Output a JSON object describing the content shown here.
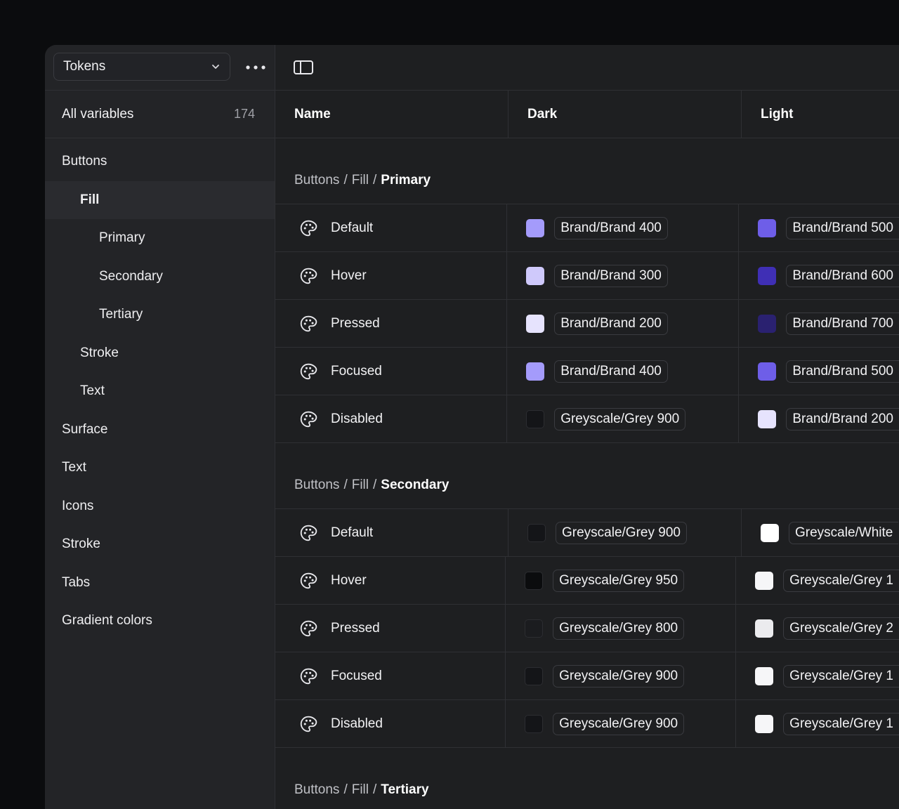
{
  "sidebar": {
    "collection": "Tokens",
    "all_variables": {
      "label": "All variables",
      "count": "174"
    },
    "groups": [
      {
        "label": "Buttons",
        "level": 0
      },
      {
        "label": "Fill",
        "level": 1,
        "active": true
      },
      {
        "label": "Primary",
        "level": 2
      },
      {
        "label": "Secondary",
        "level": 2
      },
      {
        "label": "Tertiary",
        "level": 2
      },
      {
        "label": "Stroke",
        "level": 1
      },
      {
        "label": "Text",
        "level": 1
      },
      {
        "label": "Surface",
        "level": 0
      },
      {
        "label": "Text",
        "level": 0
      },
      {
        "label": "Icons",
        "level": 0
      },
      {
        "label": "Stroke",
        "level": 0
      },
      {
        "label": "Tabs",
        "level": 0
      },
      {
        "label": "Gradient colors",
        "level": 0
      }
    ]
  },
  "table": {
    "columns": {
      "name": "Name",
      "dark": "Dark",
      "light": "Light"
    },
    "sections": [
      {
        "path": [
          "Buttons",
          "Fill",
          "Primary"
        ],
        "rows": [
          {
            "name": "Default",
            "dark": {
              "token": "Brand/Brand 400",
              "color": "#a49bfb"
            },
            "light": {
              "token": "Brand/Brand 500",
              "color": "#6e5ee8"
            }
          },
          {
            "name": "Hover",
            "dark": {
              "token": "Brand/Brand 300",
              "color": "#cfc9fb"
            },
            "light": {
              "token": "Brand/Brand 600",
              "color": "#3f2fb5"
            }
          },
          {
            "name": "Pressed",
            "dark": {
              "token": "Brand/Brand 200",
              "color": "#e6e3fd"
            },
            "light": {
              "token": "Brand/Brand 700",
              "color": "#2a2170"
            }
          },
          {
            "name": "Focused",
            "dark": {
              "token": "Brand/Brand 400",
              "color": "#a49bfb"
            },
            "light": {
              "token": "Brand/Brand 500",
              "color": "#6e5ee8"
            }
          },
          {
            "name": "Disabled",
            "dark": {
              "token": "Greyscale/Grey 900",
              "color": "#141518"
            },
            "light": {
              "token": "Brand/Brand 200",
              "color": "#e6e3fd"
            }
          }
        ]
      },
      {
        "path": [
          "Buttons",
          "Fill",
          "Secondary"
        ],
        "rows": [
          {
            "name": "Default",
            "dark": {
              "token": "Greyscale/Grey 900",
              "color": "#141518"
            },
            "light": {
              "token": "Greyscale/White",
              "color": "#ffffff"
            }
          },
          {
            "name": "Hover",
            "dark": {
              "token": "Greyscale/Grey 950",
              "color": "#0b0c0e"
            },
            "light": {
              "token": "Greyscale/Grey 1",
              "color": "#f6f6f8"
            }
          },
          {
            "name": "Pressed",
            "dark": {
              "token": "Greyscale/Grey 800",
              "color": "#1b1c1f"
            },
            "light": {
              "token": "Greyscale/Grey 2",
              "color": "#ebebee"
            }
          },
          {
            "name": "Focused",
            "dark": {
              "token": "Greyscale/Grey 900",
              "color": "#141518"
            },
            "light": {
              "token": "Greyscale/Grey 1",
              "color": "#f6f6f8"
            }
          },
          {
            "name": "Disabled",
            "dark": {
              "token": "Greyscale/Grey 900",
              "color": "#141518"
            },
            "light": {
              "token": "Greyscale/Grey 1",
              "color": "#f6f6f8"
            }
          }
        ]
      },
      {
        "path": [
          "Buttons",
          "Fill",
          "Tertiary"
        ],
        "rows": []
      }
    ]
  },
  "icons": {
    "collection_chevron": "chevron-down-icon",
    "more": "more-horizontal-icon",
    "panel": "sidebar-panel-icon",
    "row": "palette-icon"
  }
}
